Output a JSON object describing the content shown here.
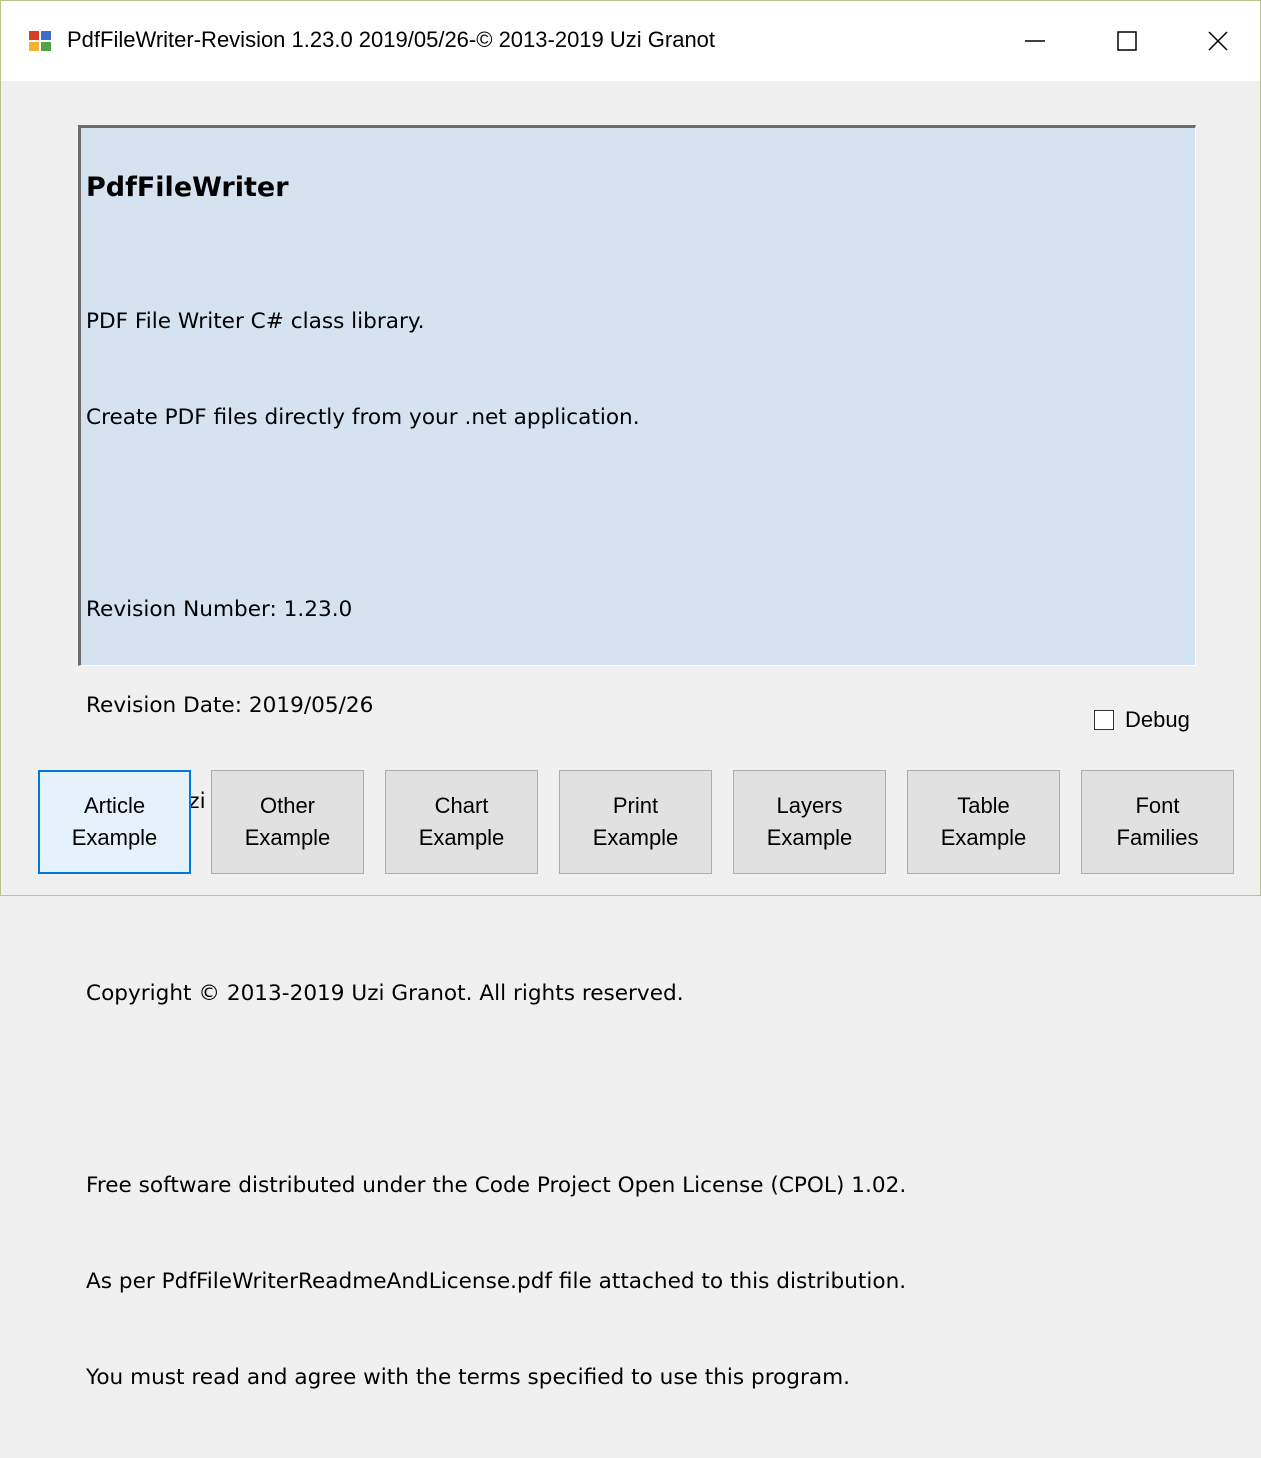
{
  "window": {
    "title": "PdfFileWriter-Revision 1.23.0 2019/05/26-© 2013-2019 Uzi Granot",
    "icon": "app-icon",
    "controls": [
      "minimize-icon",
      "maximize-icon",
      "close-icon"
    ]
  },
  "info": {
    "heading": "PdfFileWriter",
    "lines": [
      "PDF File Writer C# class library.",
      "Create PDF files directly from your .net application.",
      "",
      "Revision Number: 1.23.0",
      "Revision Date: 2019/05/26",
      "Author: Uzi Granot",
      "",
      "Copyright © 2013-2019 Uzi Granot. All rights reserved.",
      "",
      "Free software distributed under the Code Project Open License (CPOL) 1.02.",
      "As per PdfFileWriterReadmeAndLicense.pdf file attached to this distribution.",
      "You must read and agree with the terms specified to use this program."
    ],
    "background_color": "#d5e3f1"
  },
  "debug": {
    "label": "Debug",
    "checked": false
  },
  "buttons": [
    {
      "line1": "Article",
      "line2": "Example",
      "focused": true
    },
    {
      "line1": "Other",
      "line2": "Example",
      "focused": false
    },
    {
      "line1": "Chart",
      "line2": "Example",
      "focused": false
    },
    {
      "line1": "Print",
      "line2": "Example",
      "focused": false
    },
    {
      "line1": "Layers",
      "line2": "Example",
      "focused": false
    },
    {
      "line1": "Table",
      "line2": "Example",
      "focused": false
    },
    {
      "line1": "Font",
      "line2": "Families",
      "focused": false
    }
  ],
  "colors": {
    "focus_border": "#0078d7",
    "button_face": "#e1e1e1",
    "window_bg": "#f0f0f0"
  }
}
